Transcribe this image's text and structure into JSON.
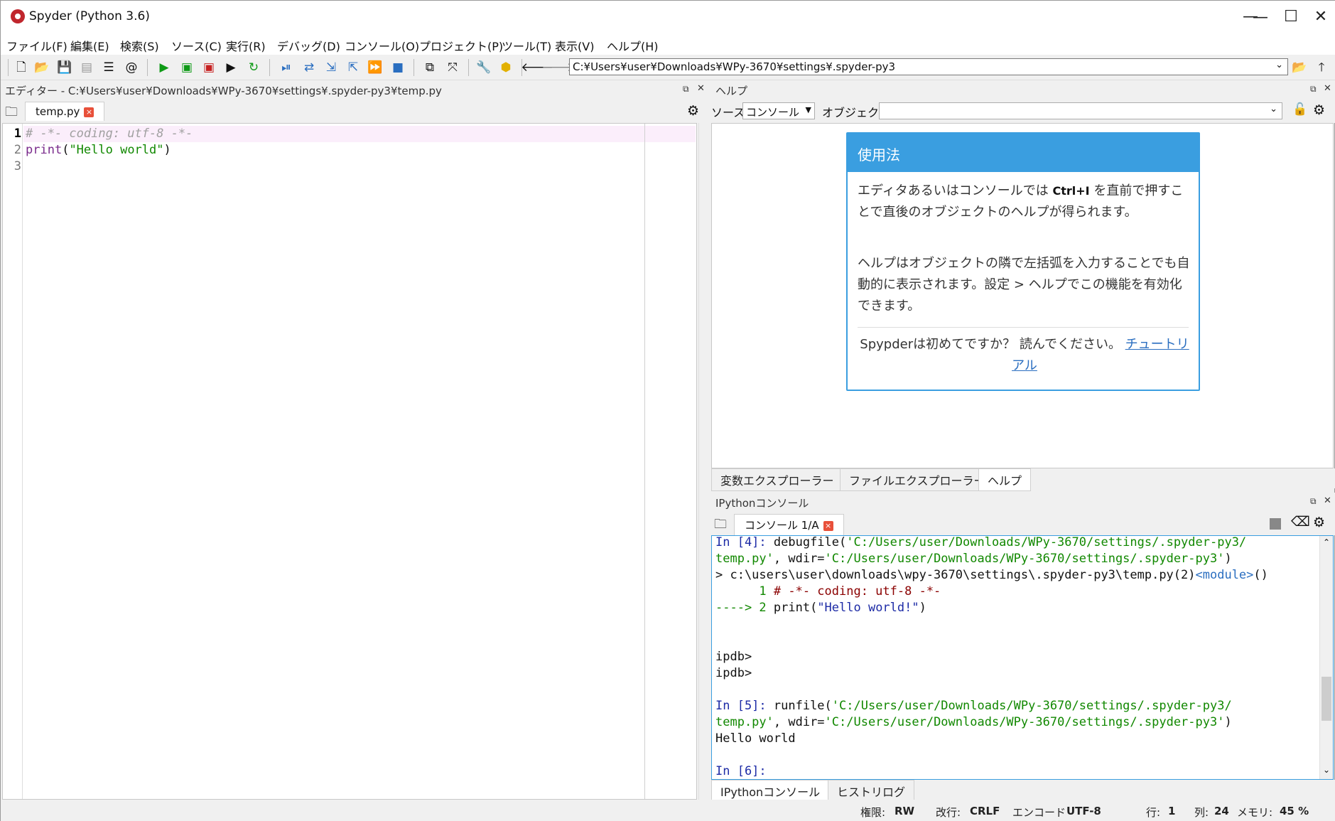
{
  "window": {
    "title": "Spyder (Python 3.6)",
    "minimize": "—",
    "maximize": "☐",
    "close": "✕"
  },
  "menu": [
    "ファイル(F)",
    "編集(E)",
    "検索(S)",
    "ソース(C)",
    "実行(R)",
    "デバッグ(D)",
    "コンソール(O)",
    "プロジェクト(P)",
    "ツール(T)",
    "表示(V)",
    "ヘルプ(H)"
  ],
  "toolbar": {
    "path": "C:¥Users¥user¥Downloads¥WPy-3670¥settings¥.spyder-py3"
  },
  "editor": {
    "title": "エディター - C:¥Users¥user¥Downloads¥WPy-3670¥settings¥.spyder-py3¥temp.py",
    "tab": "temp.py",
    "line_numbers": [
      "1",
      "2",
      "3"
    ],
    "line1": "# -*- coding: utf-8 -*-",
    "line2_fn": "print",
    "line2_open": "(",
    "line2_str": "\"Hello world\"",
    "line2_close": ")"
  },
  "help": {
    "title": "ヘルプ",
    "source_label": "ソース",
    "source_value": "コンソール",
    "object_label": "オブジェクト",
    "object_value": "",
    "card_title": "使用法",
    "para1_a": "エディタあるいはコンソールでは ",
    "para1_key": "Ctrl+I",
    "para1_b": " を直前で押すことで直後のオブジェクトのヘルプが得られます。",
    "para2": "ヘルプはオブジェクトの隣で左括弧を入力することでも自動的に表示されます。設定 > ヘルプでこの機能を有効化できます。",
    "footer_text": "Spypderは初めてですか？ 読んでください。",
    "footer_link": "チュートリアル"
  },
  "bottom_tabs": [
    "変数エクスプローラー",
    "ファイルエクスプローラー",
    "ヘルプ"
  ],
  "console": {
    "title": "IPythonコンソール",
    "tab": "コンソール 1/A",
    "l1_prompt": "In [4]: ",
    "l1_code": "debugfile(",
    "l1_str": "'C:/Users/user/Downloads/WPy-3670/settings/.spyder-py3/",
    "l2_str": "temp.py'",
    "l2_mid": ", wdir=",
    "l2_str2": "'C:/Users/user/Downloads/WPy-3670/settings/.spyder-py3'",
    "l2_end": ")",
    "l3_a": "> c:\\users\\user\\downloads\\wpy-3670\\settings\\.spyder-py3\\temp.py(2)",
    "l3_b": "<module>",
    "l3_c": "()",
    "l4_num": "      1 ",
    "l4_comment": "# -*- coding: utf-8 -*-",
    "l5_arrow": "----> 2 ",
    "l5_code": "print(",
    "l5_str": "\"Hello world!\"",
    "l5_end": ")",
    "ipdb1": "ipdb>",
    "ipdb2": "ipdb>",
    "l6_prompt": "In [5]: ",
    "l6_code": "runfile(",
    "l6_str": "'C:/Users/user/Downloads/WPy-3670/settings/.spyder-py3/",
    "l7_str": "temp.py'",
    "l7_mid": ", wdir=",
    "l7_str2": "'C:/Users/user/Downloads/WPy-3670/settings/.spyder-py3'",
    "l7_end": ")",
    "output": "Hello world",
    "l8_prompt": "In [6]:"
  },
  "console_tabs": [
    "IPythonコンソール",
    "ヒストリログ"
  ],
  "status": {
    "perm_label": "権限:",
    "perm": "RW",
    "eol_label": "改行:",
    "eol": "CRLF",
    "enc_label": "エンコード",
    "enc": "UTF-8",
    "line_label": "行:",
    "line": "1",
    "col_label": "列:",
    "col": "24",
    "mem_label": "メモリ:",
    "mem": "45 %"
  }
}
